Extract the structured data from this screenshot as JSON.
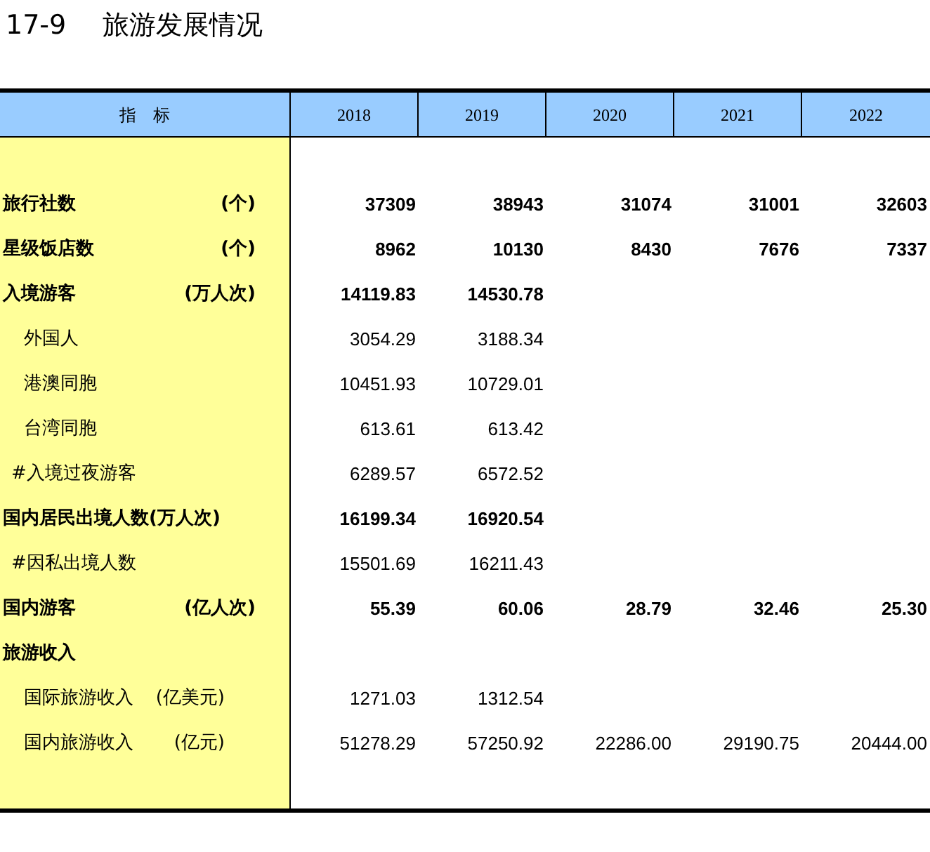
{
  "title": {
    "number": "17-9",
    "text": "旅游发展情况"
  },
  "table": {
    "columns": [
      "指　标",
      "2018",
      "2019",
      "2020",
      "2021",
      "2022"
    ],
    "rows": [
      {
        "label": "旅行社数",
        "unit": "(个)",
        "bold": true,
        "indent": false,
        "values": [
          "37309",
          "38943",
          "31074",
          "31001",
          "32603"
        ]
      },
      {
        "label": "星级饭店数",
        "unit": "(个)",
        "bold": true,
        "indent": false,
        "values": [
          "8962",
          "10130",
          "8430",
          "7676",
          "7337"
        ]
      },
      {
        "label": "入境游客",
        "unit": "(万人次)",
        "bold": true,
        "indent": false,
        "values": [
          "14119.83",
          "14530.78"
        ]
      },
      {
        "label": "外国人",
        "bold": false,
        "indent": true,
        "values": [
          "3054.29",
          "3188.34"
        ]
      },
      {
        "label": "港澳同胞",
        "bold": false,
        "indent": true,
        "values": [
          "10451.93",
          "10729.01"
        ]
      },
      {
        "label": "台湾同胞",
        "bold": false,
        "indent": true,
        "values": [
          "613.61",
          "613.42"
        ]
      },
      {
        "label": "#入境过夜游客",
        "bold": false,
        "indent": false,
        "values": [
          "6289.57",
          "6572.52"
        ]
      },
      {
        "label": "国内居民出境人数(万人次)",
        "bold": true,
        "indent": false,
        "values": [
          "16199.34",
          "16920.54"
        ]
      },
      {
        "label": "#因私出境人数",
        "bold": false,
        "indent": false,
        "values": [
          "15501.69",
          "16211.43"
        ]
      },
      {
        "label": "国内游客",
        "unit": "(亿人次)",
        "bold": true,
        "indent": false,
        "values": [
          "55.39",
          "60.06",
          "28.79",
          "32.46",
          "25.30"
        ]
      },
      {
        "label": "旅游收入",
        "bold": true,
        "indent": false,
        "values": []
      },
      {
        "label": "国际旅游收入",
        "unit": "(亿美元)",
        "bold": false,
        "indent": true,
        "values": [
          "1271.03",
          "1312.54"
        ]
      },
      {
        "label": "国内旅游收入",
        "unit": "(亿元)",
        "bold": false,
        "indent": true,
        "values": [
          "51278.29",
          "57250.92",
          "22286.00",
          "29190.75",
          "20444.00"
        ]
      }
    ]
  }
}
